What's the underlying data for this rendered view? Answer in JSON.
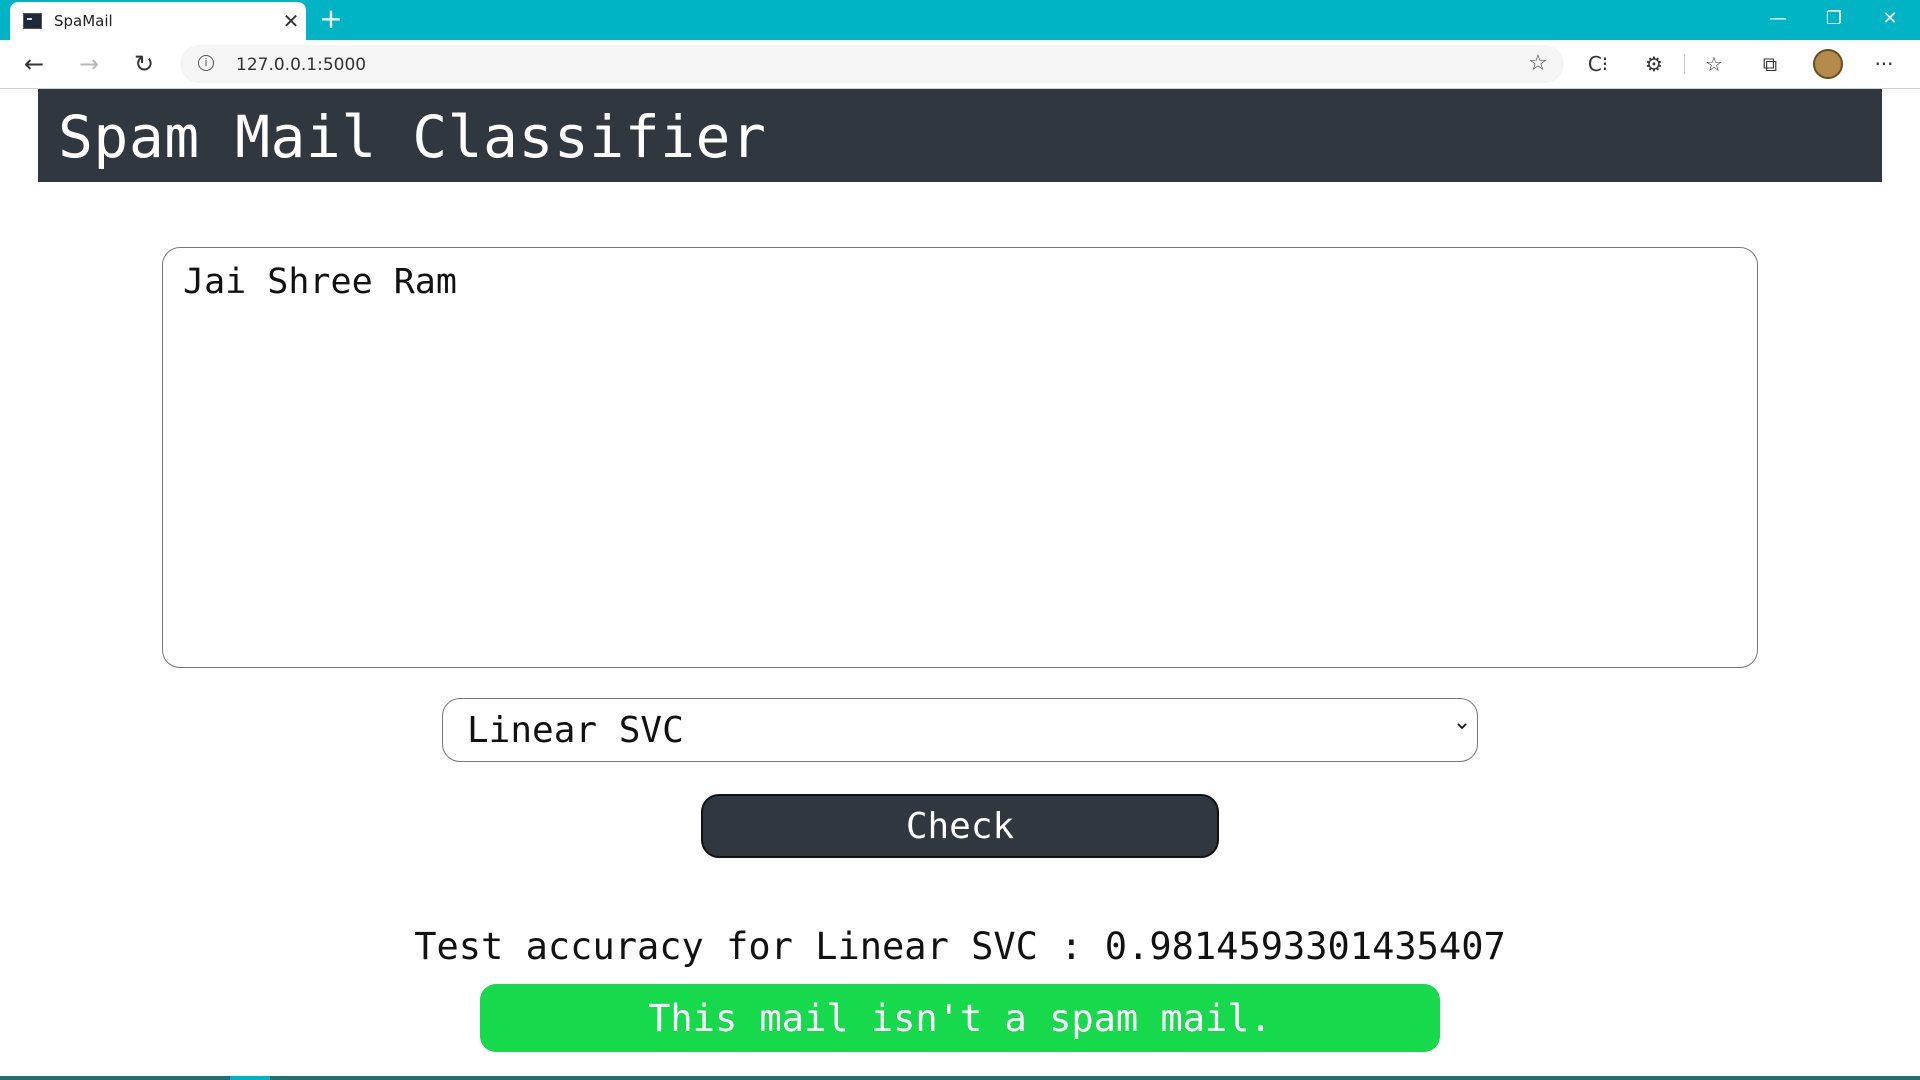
{
  "browser": {
    "tab_title": "SpaMail",
    "tab_close": "✕",
    "new_tab": "+",
    "url": "127.0.0.1:5000",
    "window_controls": {
      "minimize": "—",
      "restore": "❐",
      "close": "✕"
    },
    "nav": {
      "back": "←",
      "forward": "→",
      "reload": "↻"
    },
    "toolbar_icons": [
      "favorite-add-icon",
      "reading-mode-icon",
      "extensions-icon",
      "favorites-icon",
      "collections-icon",
      "profile-avatar",
      "more-icon"
    ],
    "glyphs": {
      "info": "i",
      "fav_add": "☆",
      "reading": "C⁝",
      "extensions": "⚙",
      "favorites": "☆",
      "collections": "⧉",
      "more": "···"
    }
  },
  "header": {
    "title": "Spam Mail Classifier",
    "background": "#31373e"
  },
  "form": {
    "mail_text": "Jai Shree Ram",
    "model_selected": "Linear SVC",
    "check_label": "Check"
  },
  "result": {
    "accuracy_text": "Test accuracy for Linear SVC : 0.9814593301435407",
    "message": "This mail isn't a spam mail.",
    "message_color": "#17d94c"
  }
}
